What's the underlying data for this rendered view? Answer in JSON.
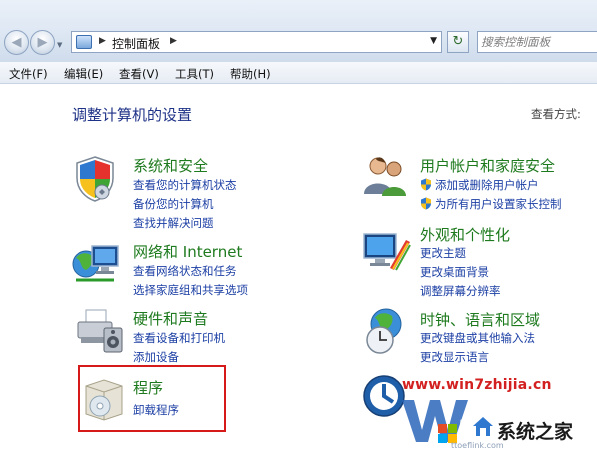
{
  "address_bar": {
    "breadcrumb": "控制面板",
    "search_placeholder": "搜索控制面板"
  },
  "menu": [
    {
      "label": "文件(F)"
    },
    {
      "label": "编辑(E)"
    },
    {
      "label": "查看(V)"
    },
    {
      "label": "工具(T)"
    },
    {
      "label": "帮助(H)"
    }
  ],
  "content": {
    "heading": "调整计算机的设置",
    "view_by_label": "查看方式:"
  },
  "categories": {
    "system_security": {
      "title": "系统和安全",
      "links": [
        "查看您的计算机状态",
        "备份您的计算机",
        "查找并解决问题"
      ],
      "icon": "shield-icon"
    },
    "network_internet": {
      "title": "网络和 Internet",
      "links": [
        "查看网络状态和任务",
        "选择家庭组和共享选项"
      ],
      "icon": "network-globe-icon"
    },
    "hardware_sound": {
      "title": "硬件和声音",
      "links": [
        "查看设备和打印机",
        "添加设备"
      ],
      "icon": "printer-icon"
    },
    "programs": {
      "title": "程序",
      "links": [
        "卸载程序"
      ],
      "icon": "programs-box-icon",
      "highlight_color": "#d61a1a"
    },
    "user_accounts": {
      "title": "用户帐户和家庭安全",
      "links": [
        "添加或删除用户帐户",
        "为所有用户设置家长控制"
      ],
      "icon": "users-icon"
    },
    "appearance": {
      "title": "外观和个性化",
      "links": [
        "更改主题",
        "更改桌面背景",
        "调整屏幕分辨率"
      ],
      "icon": "monitor-palette-icon"
    },
    "clock_region": {
      "title": "时钟、语言和区域",
      "links": [
        "更改键盘或其他输入法",
        "更改显示语言"
      ],
      "icon": "globe-clock-icon"
    }
  },
  "watermark": {
    "url": "www.win7zhijia.cn",
    "name": "系统之家",
    "small": "ttoeflink.com"
  },
  "colors": {
    "category_title": "#1e7a1e",
    "link": "#1c3fa4",
    "heading": "#1e3287",
    "highlight": "#d61a1a"
  }
}
